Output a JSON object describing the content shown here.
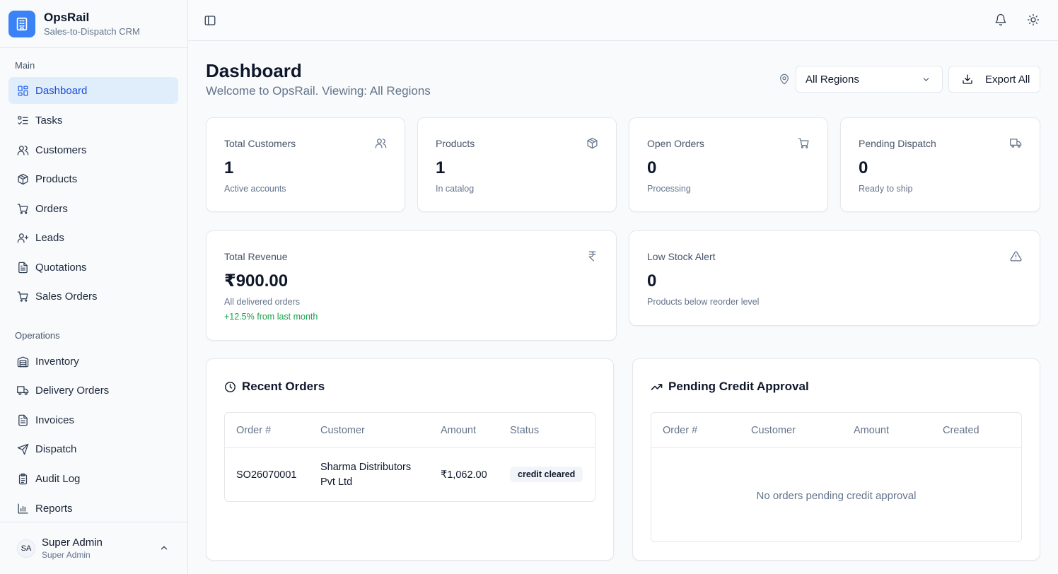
{
  "brand": {
    "name": "OpsRail",
    "subtitle": "Sales-to-Dispatch CRM",
    "icon": "building-icon",
    "color": "#3b82f6"
  },
  "sidebar": {
    "main_label": "Main",
    "main_items": [
      {
        "label": "Dashboard",
        "icon": "layout-dashboard-icon",
        "active": true
      },
      {
        "label": "Tasks",
        "icon": "list-todo-icon"
      },
      {
        "label": "Customers",
        "icon": "users-icon"
      },
      {
        "label": "Products",
        "icon": "package-icon"
      },
      {
        "label": "Orders",
        "icon": "shopping-cart-icon"
      },
      {
        "label": "Leads",
        "icon": "user-plus-icon"
      },
      {
        "label": "Quotations",
        "icon": "file-text-icon"
      },
      {
        "label": "Sales Orders",
        "icon": "shopping-cart-icon"
      }
    ],
    "ops_label": "Operations",
    "ops_items": [
      {
        "label": "Inventory",
        "icon": "warehouse-icon"
      },
      {
        "label": "Delivery Orders",
        "icon": "truck-icon"
      },
      {
        "label": "Invoices",
        "icon": "file-text-icon"
      },
      {
        "label": "Dispatch",
        "icon": "send-icon"
      },
      {
        "label": "Audit Log",
        "icon": "clipboard-list-icon"
      },
      {
        "label": "Reports",
        "icon": "bar-chart-icon"
      }
    ]
  },
  "user": {
    "initials": "SA",
    "name": "Super Admin",
    "role": "Super Admin"
  },
  "topbar": {
    "toggle_icon": "sidebar-toggle-icon",
    "bell_icon": "bell-icon",
    "theme_icon": "sun-icon"
  },
  "page": {
    "title": "Dashboard",
    "subtitle": "Welcome to OpsRail. Viewing: All Regions",
    "region_selected": "All Regions",
    "export_label": "Export All"
  },
  "stats": [
    {
      "label": "Total Customers",
      "value": "1",
      "caption": "Active accounts",
      "icon": "users-icon"
    },
    {
      "label": "Products",
      "value": "1",
      "caption": "In catalog",
      "icon": "package-icon"
    },
    {
      "label": "Open Orders",
      "value": "0",
      "caption": "Processing",
      "icon": "shopping-cart-icon"
    },
    {
      "label": "Pending Dispatch",
      "value": "0",
      "caption": "Ready to ship",
      "icon": "truck-icon"
    }
  ],
  "revenue": {
    "label": "Total Revenue",
    "value": "₹900.00",
    "caption": "All delivered orders",
    "trend": "+12.5% from last month",
    "trend_color": "#16a34a",
    "icon": "rupee-icon"
  },
  "low_stock": {
    "label": "Low Stock Alert",
    "value": "0",
    "caption": "Products below reorder level",
    "icon": "alert-triangle-icon"
  },
  "recent_orders": {
    "title": "Recent Orders",
    "columns": [
      "Order #",
      "Customer",
      "Amount",
      "Status"
    ],
    "rows": [
      {
        "order": "SO26070001",
        "customer": "Sharma Distributors Pvt Ltd",
        "amount": "₹1,062.00",
        "status": "credit cleared"
      }
    ]
  },
  "credit_approval": {
    "title": "Pending Credit Approval",
    "columns": [
      "Order #",
      "Customer",
      "Amount",
      "Created"
    ],
    "empty": "No orders pending credit approval"
  }
}
